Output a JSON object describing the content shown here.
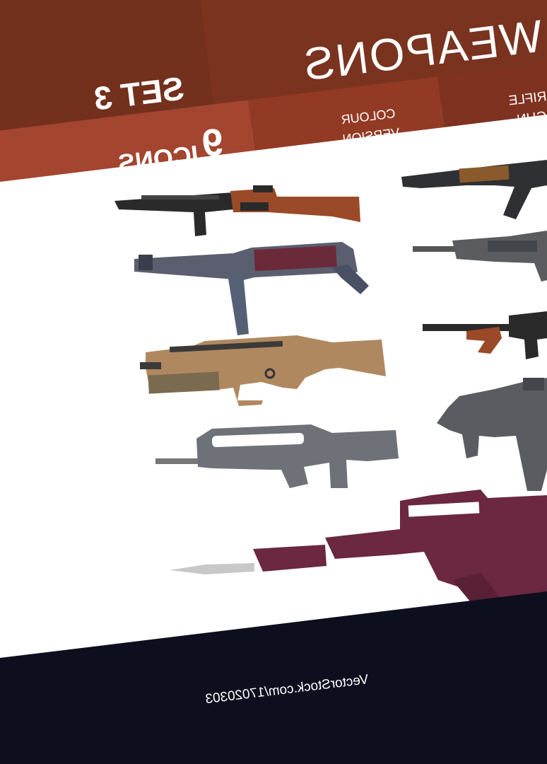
{
  "header": {
    "title": "WEAPONS",
    "set_label": "SET 3",
    "icons_count": "9",
    "icons_label": "ICONS",
    "version_line1": "COLOUR",
    "version_line2": "VERSION",
    "category_line1": "RIFLE",
    "category_line2": "GUN"
  },
  "footer": {
    "credit": "VectorStock.com/17020303"
  },
  "colors": {
    "header_dark": "#7a331f",
    "header_mid": "#9a3c27",
    "header_light": "#b04a32",
    "paper": "#ffffff",
    "background": "#0d0f1e"
  },
  "icons": [
    {
      "name": "ppsh-smg-icon"
    },
    {
      "name": "mp40-smg-icon"
    },
    {
      "name": "scar-rifle-icon"
    },
    {
      "name": "famas-rifle-icon"
    },
    {
      "name": "groza-bayonet-rifle-icon"
    },
    {
      "name": "ak47-rifle-icon"
    },
    {
      "name": "m16-rifle-icon"
    },
    {
      "name": "tommy-gun-icon"
    },
    {
      "name": "kriss-vector-smg-icon"
    }
  ]
}
